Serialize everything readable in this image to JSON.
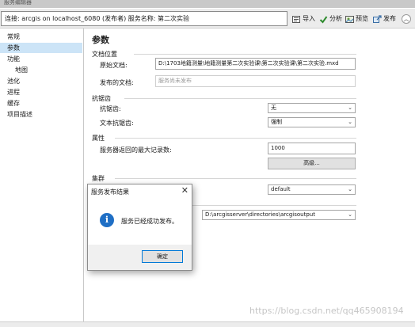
{
  "window": {
    "title": "服务编辑器"
  },
  "toolbar": {
    "connection_text": "连接: arcgis on localhost_6080 (发布者)  服务名称: 第二次实验",
    "import_label": "导入",
    "analyze_label": "分析",
    "preview_label": "预览",
    "publish_label": "发布",
    "collapse_glyph": "︿"
  },
  "sidebar": {
    "items": [
      {
        "label": "常规"
      },
      {
        "label": "参数"
      },
      {
        "label": "功能"
      },
      {
        "label": "地图"
      },
      {
        "label": "池化"
      },
      {
        "label": "进程"
      },
      {
        "label": "缓存"
      },
      {
        "label": "项目描述"
      }
    ]
  },
  "params": {
    "heading": "参数",
    "doc_location": {
      "section": "文档位置",
      "source_label": "原始文档:",
      "source_value": "D:\\1703地籍测量\\地籍测量第二次实验课\\第二次实验课\\第二次实验.mxd",
      "published_label": "发布的文档:",
      "published_placeholder": "服务尚未发布"
    },
    "antialias": {
      "section": "抗锯齿",
      "label": "抗锯齿:",
      "value": "无",
      "text_label": "文本抗锯齿:",
      "text_value": "强制"
    },
    "properties": {
      "section": "属性",
      "max_records_label": "服务器返回的最大记录数:",
      "max_records_value": "1000",
      "advanced_button": "高级..."
    },
    "cluster": {
      "section": "集群",
      "value": "default"
    },
    "output_dir": {
      "value": "D:\\arcgisserver\\directories\\arcgisoutput"
    }
  },
  "dialog": {
    "title": "服务发布结果",
    "close_glyph": "✕",
    "icon_glyph": "i",
    "message": "服务已经成功发布。",
    "ok_label": "确定"
  },
  "watermark": {
    "text": "https://blog.csdn.net/qq465908194"
  },
  "colors": {
    "nav_active": "#cce4f7",
    "info_icon": "#1f6fc5",
    "ok_border": "#0078d7",
    "analyze_check": "#2e8b2e"
  }
}
